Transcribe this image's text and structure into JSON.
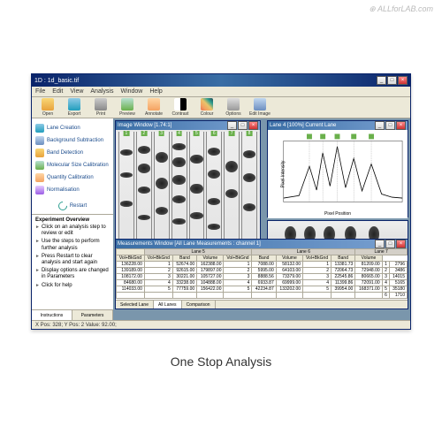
{
  "watermark": "⊕ ALLforLAB.com",
  "caption": "One Stop Analysis",
  "app": {
    "title": "1D : 1d_basic.tif"
  },
  "menu": [
    "File",
    "Edit",
    "View",
    "Analysis",
    "Window",
    "Help"
  ],
  "toolbar": [
    {
      "label": "Open",
      "icon": "open"
    },
    {
      "label": "Export",
      "icon": "export"
    },
    {
      "label": "Print",
      "icon": "print"
    },
    {
      "label": "Preview",
      "icon": "preview"
    },
    {
      "label": "Annotate",
      "icon": "annotate"
    },
    {
      "label": "Contrast",
      "icon": "contrast"
    },
    {
      "label": "Colour",
      "icon": "colour"
    },
    {
      "label": "Options",
      "icon": "options"
    },
    {
      "label": "Edit Image",
      "icon": "edit"
    }
  ],
  "sidebar": {
    "items": [
      "Lane Creation",
      "Background Subtraction",
      "Band Detection",
      "Molecular Size Calibration",
      "Quantity Calibration",
      "Normalisation"
    ],
    "restart": "Restart",
    "overview_title": "Experiment Overview",
    "overview": [
      "Click on an analysis step to review or edit",
      "Use the steps to perform further analysis",
      "Press Restart to clear analysis and start again",
      "Display options are changed in Parameters",
      "Click for help"
    ],
    "tabs": [
      "Instructions",
      "Parameters"
    ]
  },
  "image_window": {
    "title": "Image Window [1.74:1]"
  },
  "lane_window": {
    "title": "Lane 4 [100%] Current Lane"
  },
  "chart_data": {
    "type": "line",
    "title": "",
    "xlabel": "Pixel Position",
    "ylabel": "Pixel Intensity",
    "x": [
      0,
      15,
      25,
      32,
      38,
      45,
      52,
      60,
      68,
      76,
      85,
      95,
      105,
      115
    ],
    "y": [
      5,
      8,
      45,
      15,
      62,
      20,
      70,
      18,
      55,
      14,
      48,
      10,
      6,
      5
    ],
    "peaks": [
      1,
      2,
      3,
      4,
      5
    ],
    "peak_x": [
      25,
      38,
      52,
      68,
      85
    ]
  },
  "table_window": {
    "title": "Measurements Window [All Lane Measurements : channel 1]"
  },
  "table": {
    "groups": [
      "Lane 5",
      "Lane 6",
      "Lane 7"
    ],
    "cols": [
      "Vol+BkGnd",
      "Band",
      "Volume"
    ],
    "rows": [
      [
        "136228.00",
        "1",
        "52674.00",
        "162388.00",
        "1",
        "7088.00",
        "58132.00",
        "1",
        "13381.73",
        "81209.00",
        "1",
        "2796"
      ],
      [
        "139189.00",
        "2",
        "92615.00",
        "179897.00",
        "2",
        "5995.00",
        "64103.00",
        "2",
        "72064.73",
        "72948.00",
        "2",
        "3486"
      ],
      [
        "108172.00",
        "3",
        "30221.00",
        "105727.00",
        "3",
        "8888.56",
        "73379.00",
        "3",
        "22545.86",
        "80665.00",
        "3",
        "14015"
      ],
      [
        "84680.00",
        "4",
        "33238.00",
        "104888.00",
        "4",
        "6933.87",
        "69999.00",
        "4",
        "11399.86",
        "72091.00",
        "4",
        "5165"
      ],
      [
        "114033.00",
        "5",
        "77759.00",
        "156422.00",
        "5",
        "42234.87",
        "133202.00",
        "5",
        "39954.00",
        "168371.00",
        "5",
        "35180"
      ],
      [
        "",
        "",
        "",
        "",
        "",
        "",
        "",
        "",
        "",
        "",
        "6",
        "1710"
      ]
    ],
    "tabs": [
      "Selected Lane",
      "All Lanes",
      "Comparison"
    ]
  },
  "status": "X Pos: 328; Y Pos: 2 Value: 92.00;"
}
